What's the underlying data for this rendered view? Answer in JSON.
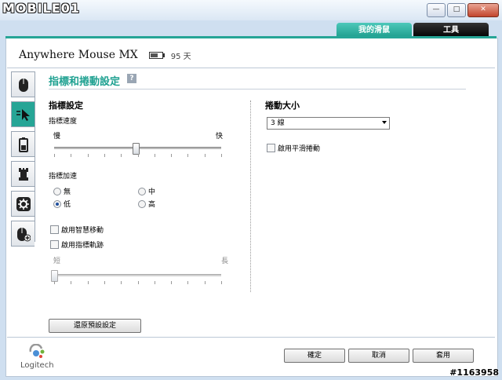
{
  "watermark": "MOBILE01",
  "window": {
    "min": "—",
    "max": "□",
    "close": "✕"
  },
  "tabs": [
    {
      "label": "我的滑鼠"
    },
    {
      "label": "工具"
    }
  ],
  "device": {
    "name": "Anywhere Mouse MX",
    "battery_days": "95 天"
  },
  "sidebar": {
    "icons": [
      "mouse-icon",
      "pointer-icon",
      "battery-icon",
      "chess-rook-icon",
      "gear-icon",
      "mouse-plus-icon"
    ]
  },
  "heading": "指標和捲動設定",
  "help_icon": "?",
  "pointer": {
    "section": "指標設定",
    "speed_label": "指標速度",
    "slow": "慢",
    "fast": "快",
    "speed_level": 0.49,
    "accel_label": "指標加速",
    "accel_options": [
      {
        "label": "無",
        "checked": false
      },
      {
        "label": "中",
        "checked": false
      },
      {
        "label": "低",
        "checked": true
      },
      {
        "label": "高",
        "checked": false
      }
    ],
    "smart_move": "啟用智慧移動",
    "trails": "啟用指標軌跡",
    "short": "短",
    "long": "長",
    "trails_level": 0
  },
  "scroll": {
    "section": "捲動大小",
    "selected": "3 線",
    "smooth": "啟用平滑捲動"
  },
  "buttons": {
    "restore": "還原預設設定",
    "ok": "確定",
    "cancel": "取消",
    "apply": "套用"
  },
  "logo_text": "Logitech",
  "post_id": "#1163958"
}
